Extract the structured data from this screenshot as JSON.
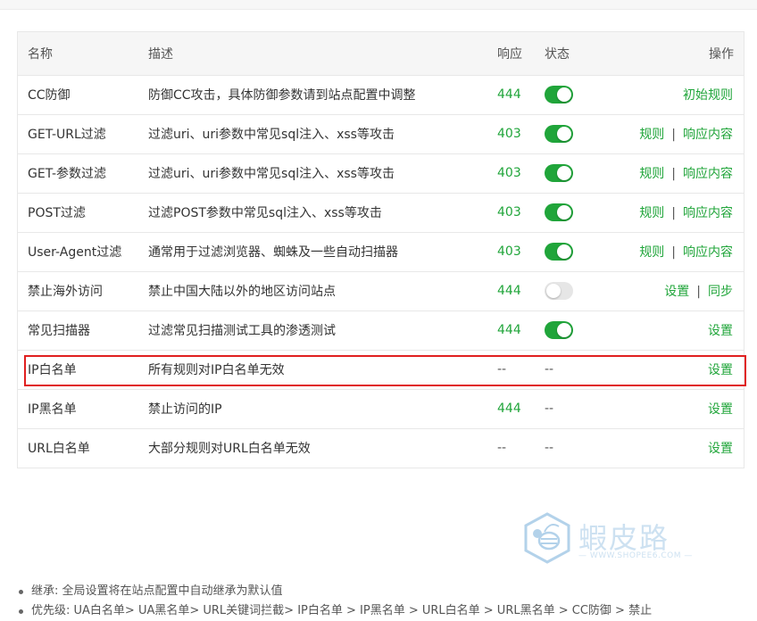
{
  "table": {
    "headers": {
      "name": "名称",
      "desc": "描述",
      "response": "响应",
      "status": "状态",
      "ops": "操作"
    },
    "rows": [
      {
        "name": "CC防御",
        "desc": "防御CC攻击，具体防御参数请到站点配置中调整",
        "response": "444",
        "status": "on",
        "ops": [
          "初始规则"
        ]
      },
      {
        "name": "GET-URL过滤",
        "desc": "过滤uri、uri参数中常见sql注入、xss等攻击",
        "response": "403",
        "status": "on",
        "ops": [
          "规则",
          "响应内容"
        ]
      },
      {
        "name": "GET-参数过滤",
        "desc": "过滤uri、uri参数中常见sql注入、xss等攻击",
        "response": "403",
        "status": "on",
        "ops": [
          "规则",
          "响应内容"
        ]
      },
      {
        "name": "POST过滤",
        "desc": "过滤POST参数中常见sql注入、xss等攻击",
        "response": "403",
        "status": "on",
        "ops": [
          "规则",
          "响应内容"
        ]
      },
      {
        "name": "User-Agent过滤",
        "desc": "通常用于过滤浏览器、蜘蛛及一些自动扫描器",
        "response": "403",
        "status": "on",
        "ops": [
          "规则",
          "响应内容"
        ]
      },
      {
        "name": "禁止海外访问",
        "desc": "禁止中国大陆以外的地区访问站点",
        "response": "444",
        "status": "off",
        "ops": [
          "设置",
          "同步"
        ]
      },
      {
        "name": "常见扫描器",
        "desc": "过滤常见扫描测试工具的渗透测试",
        "response": "444",
        "status": "on",
        "ops": [
          "设置"
        ]
      },
      {
        "name": "IP白名单",
        "desc": "所有规则对IP白名单无效",
        "response": "--",
        "status": "--",
        "ops": [
          "设置"
        ]
      },
      {
        "name": "IP黑名单",
        "desc": "禁止访问的IP",
        "response": "444",
        "status": "--",
        "ops": [
          "设置"
        ]
      },
      {
        "name": "URL白名单",
        "desc": "大部分规则对URL白名单无效",
        "response": "--",
        "status": "--",
        "ops": [
          "设置"
        ]
      }
    ]
  },
  "watermark": {
    "brand": "蝦皮路",
    "url": "— WWW.SHOPEE6.COM —",
    "icon": "bee-hexagon-logo-icon"
  },
  "notes": [
    "继承: 全局设置将在站点配置中自动继承为默认值",
    "优先级: UA白名单> UA黑名单> URL关键词拦截> IP白名单 > IP黑名单 > URL白名单 > URL黑名单 > CC防御 > 禁止"
  ],
  "colors": {
    "accent": "#20a53a",
    "highlight": "#e02020",
    "toggle_off": "#e6e6e6"
  }
}
